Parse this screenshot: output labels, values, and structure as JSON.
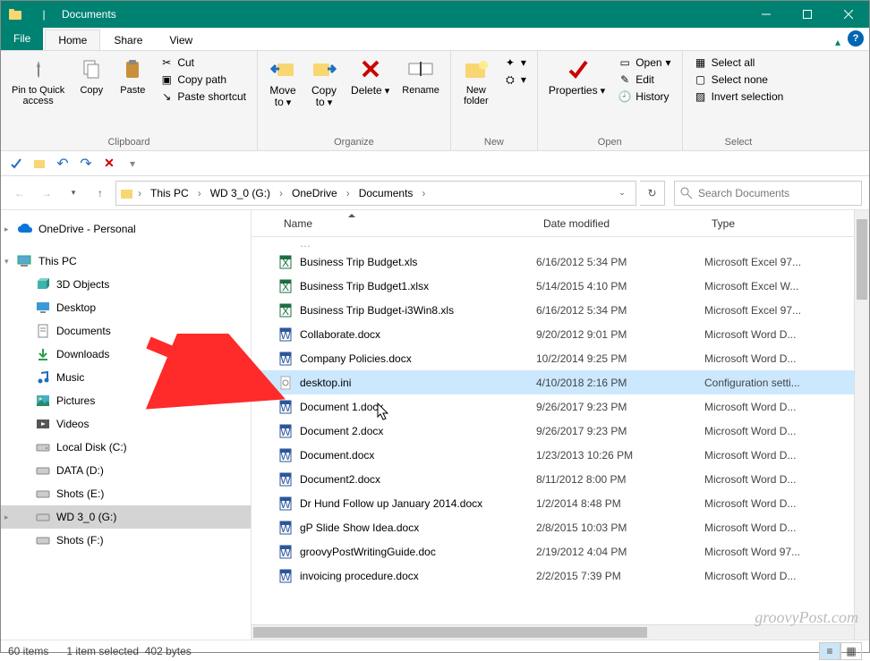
{
  "window": {
    "title": "Documents"
  },
  "tabs": {
    "file": "File",
    "home": "Home",
    "share": "Share",
    "view": "View"
  },
  "ribbon": {
    "pin": "Pin to Quick\naccess",
    "copy": "Copy",
    "paste": "Paste",
    "cut": "Cut",
    "copypath": "Copy path",
    "pasteshortcut": "Paste shortcut",
    "clipboard": "Clipboard",
    "moveto": "Move\nto",
    "copyto": "Copy\nto",
    "delete": "Delete",
    "rename": "Rename",
    "organize": "Organize",
    "newfolder": "New\nfolder",
    "new": "New",
    "properties": "Properties",
    "open": "Open",
    "edit": "Edit",
    "history": "History",
    "opengrp": "Open",
    "selectall": "Select all",
    "selectnone": "Select none",
    "invert": "Invert selection",
    "select": "Select"
  },
  "breadcrumbs": [
    "This PC",
    "WD 3_0 (G:)",
    "OneDrive",
    "Documents"
  ],
  "search": {
    "placeholder": "Search Documents"
  },
  "sidebar": {
    "onedrive": "OneDrive - Personal",
    "thispc": "This PC",
    "items": [
      "3D Objects",
      "Desktop",
      "Documents",
      "Downloads",
      "Music",
      "Pictures",
      "Videos",
      "Local Disk (C:)",
      "DATA (D:)",
      "Shots (E:)",
      "WD 3_0 (G:)",
      "Shots (F:)"
    ]
  },
  "cols": {
    "name": "Name",
    "date": "Date modified",
    "type": "Type"
  },
  "files": [
    {
      "icon": "xls",
      "name": "Business Trip Budget.xls",
      "date": "6/16/2012 5:34 PM",
      "type": "Microsoft Excel 97..."
    },
    {
      "icon": "xlsx",
      "name": "Business Trip Budget1.xlsx",
      "date": "5/14/2015 4:10 PM",
      "type": "Microsoft Excel W..."
    },
    {
      "icon": "xls",
      "name": "Business Trip Budget-i3Win8.xls",
      "date": "6/16/2012 5:34 PM",
      "type": "Microsoft Excel 97..."
    },
    {
      "icon": "docx",
      "name": "Collaborate.docx",
      "date": "9/20/2012 9:01 PM",
      "type": "Microsoft Word D..."
    },
    {
      "icon": "docx",
      "name": "Company Policies.docx",
      "date": "10/2/2014 9:25 PM",
      "type": "Microsoft Word D..."
    },
    {
      "icon": "ini",
      "name": "desktop.ini",
      "date": "4/10/2018 2:16 PM",
      "type": "Configuration setti...",
      "selected": true
    },
    {
      "icon": "docx",
      "name": "Document 1.docx",
      "date": "9/26/2017 9:23 PM",
      "type": "Microsoft Word D..."
    },
    {
      "icon": "docx",
      "name": "Document 2.docx",
      "date": "9/26/2017 9:23 PM",
      "type": "Microsoft Word D..."
    },
    {
      "icon": "docx",
      "name": "Document.docx",
      "date": "1/23/2013 10:26 PM",
      "type": "Microsoft Word D..."
    },
    {
      "icon": "docx",
      "name": "Document2.docx",
      "date": "8/11/2012 8:00 PM",
      "type": "Microsoft Word D..."
    },
    {
      "icon": "docx",
      "name": "Dr Hund Follow up January 2014.docx",
      "date": "1/2/2014 8:48 PM",
      "type": "Microsoft Word D..."
    },
    {
      "icon": "docx",
      "name": "gP Slide Show Idea.docx",
      "date": "2/8/2015 10:03 PM",
      "type": "Microsoft Word D..."
    },
    {
      "icon": "doc",
      "name": "groovyPostWritingGuide.doc",
      "date": "2/19/2012 4:04 PM",
      "type": "Microsoft Word 97..."
    },
    {
      "icon": "docx",
      "name": "invoicing procedure.docx",
      "date": "2/2/2015 7:39 PM",
      "type": "Microsoft Word D..."
    }
  ],
  "status": {
    "count": "60 items",
    "selected": "1 item selected",
    "size": "402 bytes"
  },
  "watermark": "groovyPost.com"
}
